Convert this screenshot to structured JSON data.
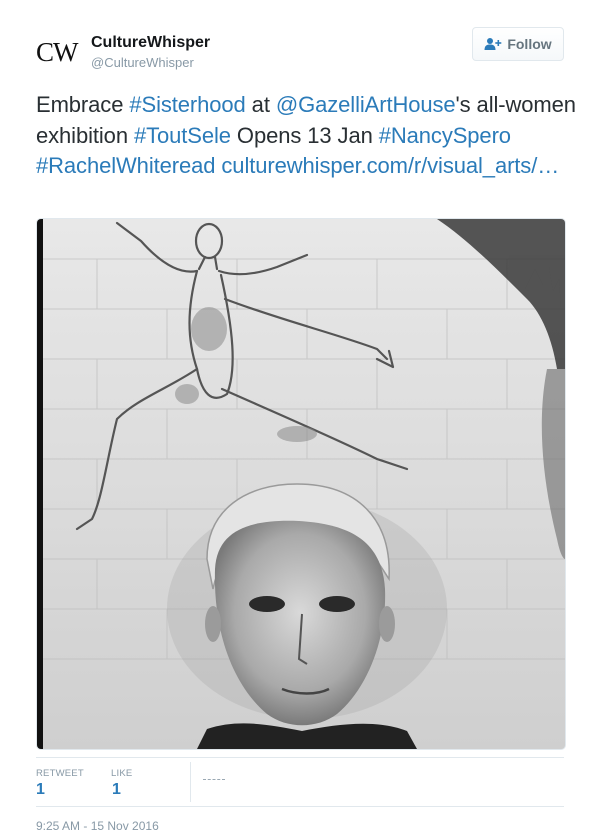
{
  "author": {
    "avatar_text": "CW",
    "name": "CultureWhisper",
    "handle": "@CultureWhisper"
  },
  "follow_button": {
    "label": "Follow",
    "icon": "follow-person-plus-icon"
  },
  "tweet": {
    "segments": [
      {
        "text": "Embrace ",
        "link": false
      },
      {
        "text": "#Sisterhood",
        "link": true
      },
      {
        "text": " at ",
        "link": false
      },
      {
        "text": "@GazelliArtHouse",
        "link": true
      },
      {
        "text": "'s all-women exhibition ",
        "link": false
      },
      {
        "text": "#ToutSele",
        "link": true
      },
      {
        "text": " Opens 13 Jan ",
        "link": false
      },
      {
        "text": "#NancySpero",
        "link": true
      },
      {
        "text": " ",
        "link": false
      },
      {
        "text": "#RachelWhiteread",
        "link": true
      },
      {
        "text": " ",
        "link": false
      },
      {
        "text": "culturewhisper.com/r/visual_arts/…",
        "link": true
      }
    ]
  },
  "stats": {
    "retweet_label": "RETWEET",
    "retweet_count": "1",
    "like_label": "LIKE",
    "like_count": "1"
  },
  "timestamp": "9:25 AM - 15 Nov 2016",
  "colors": {
    "link": "#2b7bb9",
    "text": "#292f33",
    "secondary": "#8899a6",
    "border": "#e1e8ed"
  }
}
